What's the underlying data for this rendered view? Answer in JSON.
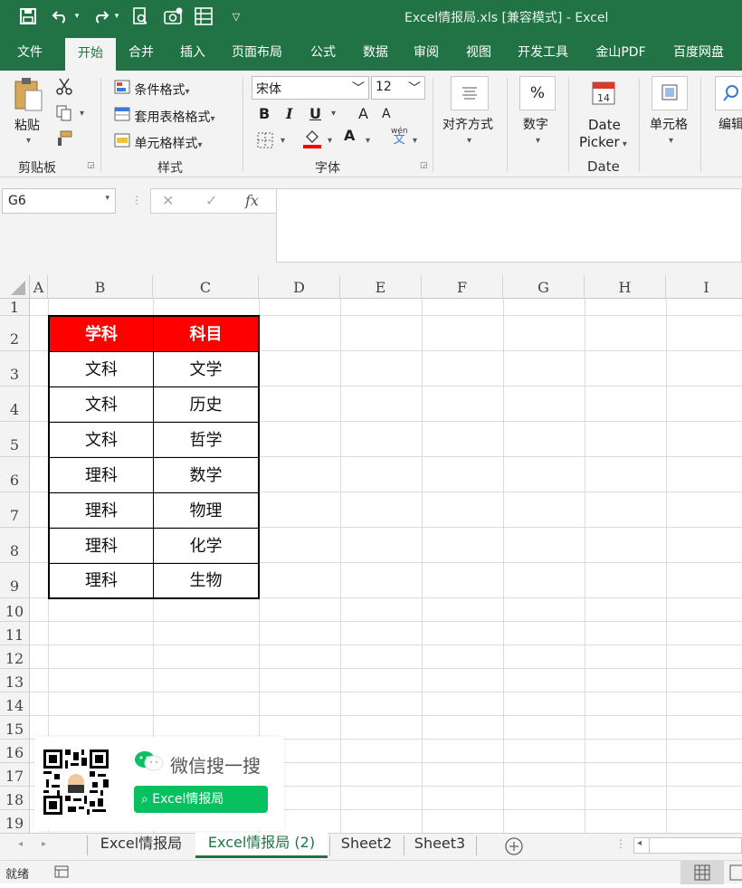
{
  "window": {
    "title": "Excel情报局.xls  [兼容模式]  -  Excel"
  },
  "ribbon_tabs": [
    "文件",
    "开始",
    "合并",
    "插入",
    "页面布局",
    "公式",
    "数据",
    "审阅",
    "视图",
    "开发工具",
    "金山PDF",
    "百度网盘"
  ],
  "active_tab": "开始",
  "ribbon": {
    "clipboard": {
      "paste": "粘贴",
      "group": "剪贴板"
    },
    "styles": {
      "conditional": "条件格式",
      "table": "套用表格格式",
      "cell": "单元格样式",
      "group": "样式"
    },
    "font": {
      "name": "宋体",
      "size": "12",
      "bold": "B",
      "italic": "I",
      "underline": "U",
      "grow": "A",
      "shrink": "A",
      "phonetic_top": "wén",
      "phonetic_bottom": "文",
      "color_a": "A",
      "group": "字体"
    },
    "alignment": {
      "label": "对齐方式"
    },
    "number": {
      "label": "数字",
      "symbol": "%"
    },
    "datepicker": {
      "line1": "Date",
      "line2": "Picker",
      "group": "Date",
      "day": "14"
    },
    "cells": {
      "label": "单元格"
    },
    "editing": {
      "label": "编辑"
    }
  },
  "formula_bar": {
    "name_box": "G6",
    "cancel": "✕",
    "enter": "✓",
    "fx": "fx",
    "content": ""
  },
  "columns": [
    "A",
    "B",
    "C",
    "D",
    "E",
    "F",
    "G",
    "H",
    "I"
  ],
  "rows": [
    "1",
    "2",
    "3",
    "4",
    "5",
    "6",
    "7",
    "8",
    "9",
    "10",
    "11",
    "12",
    "13",
    "14",
    "15",
    "16",
    "17",
    "18",
    "19"
  ],
  "table": {
    "headers": [
      "学科",
      "科目"
    ],
    "rows": [
      [
        "文科",
        "文学"
      ],
      [
        "文科",
        "历史"
      ],
      [
        "文科",
        "哲学"
      ],
      [
        "理科",
        "数学"
      ],
      [
        "理科",
        "物理"
      ],
      [
        "理科",
        "化学"
      ],
      [
        "理科",
        "生物"
      ]
    ],
    "header_color": "#ff0000"
  },
  "overlay": {
    "wechat_text": "微信搜一搜",
    "search_label": "Excel情报局"
  },
  "sheets": [
    "Excel情报局",
    "Excel情报局 (2)",
    "Sheet2",
    "Sheet3"
  ],
  "active_sheet": "Excel情报局 (2)",
  "status": {
    "ready": "就绪"
  },
  "colors": {
    "accent": "#217346",
    "wechat_green": "#07c160"
  }
}
